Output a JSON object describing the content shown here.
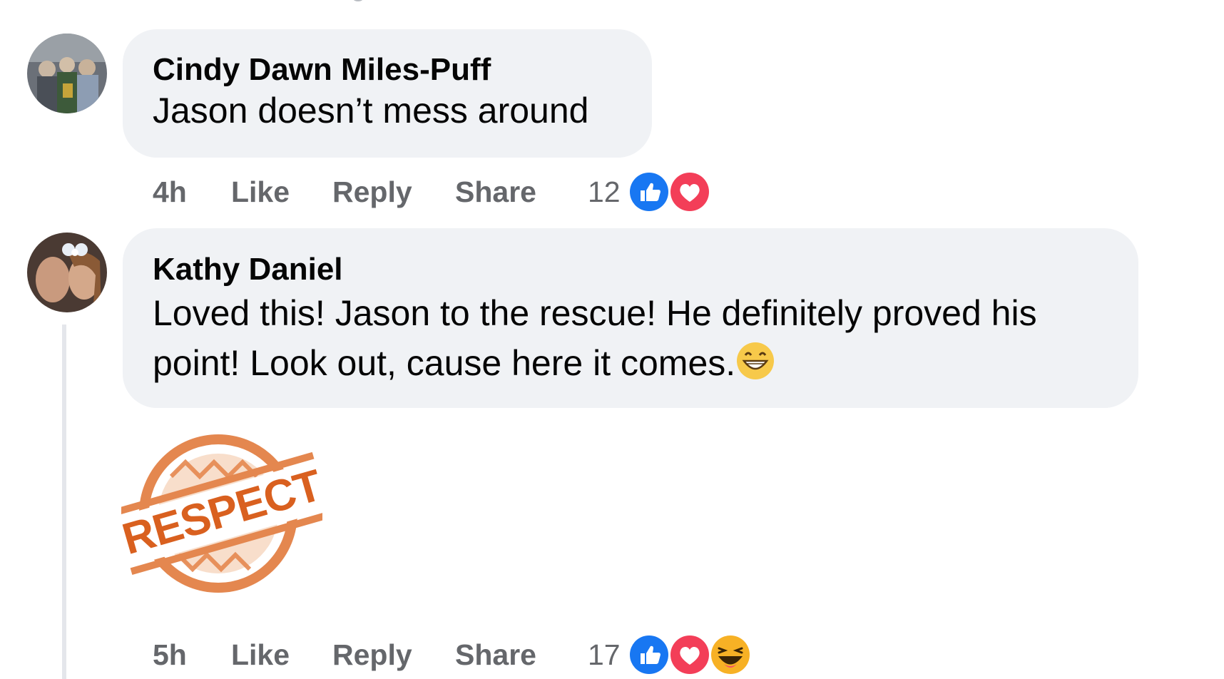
{
  "comments": [
    {
      "author": "Cindy Dawn Miles-Puff",
      "text": "Jason doesn’t mess around",
      "time": "4h",
      "like_label": "Like",
      "reply_label": "Reply",
      "share_label": "Share",
      "reaction_count": "12",
      "reactions": [
        "like-reaction-icon",
        "love-reaction-icon"
      ]
    },
    {
      "author": "Kathy Daniel",
      "text_line1": "Loved this! Jason to the rescue! He definitely proved his",
      "text_line2": "point! Look out, cause here it comes.",
      "inline_emoji": "grinning-face-emoji",
      "sticker_text": "RESPECT",
      "time": "5h",
      "like_label": "Like",
      "reply_label": "Reply",
      "share_label": "Share",
      "reaction_count": "17",
      "reactions": [
        "like-reaction-icon",
        "love-reaction-icon",
        "haha-reaction-icon"
      ]
    }
  ],
  "colors": {
    "bubble": "#f0f2f5",
    "meta_text": "#65676b",
    "like_blue": "#1877f2",
    "love_red": "#f33e58",
    "sticker_orange": "#d9601f"
  }
}
